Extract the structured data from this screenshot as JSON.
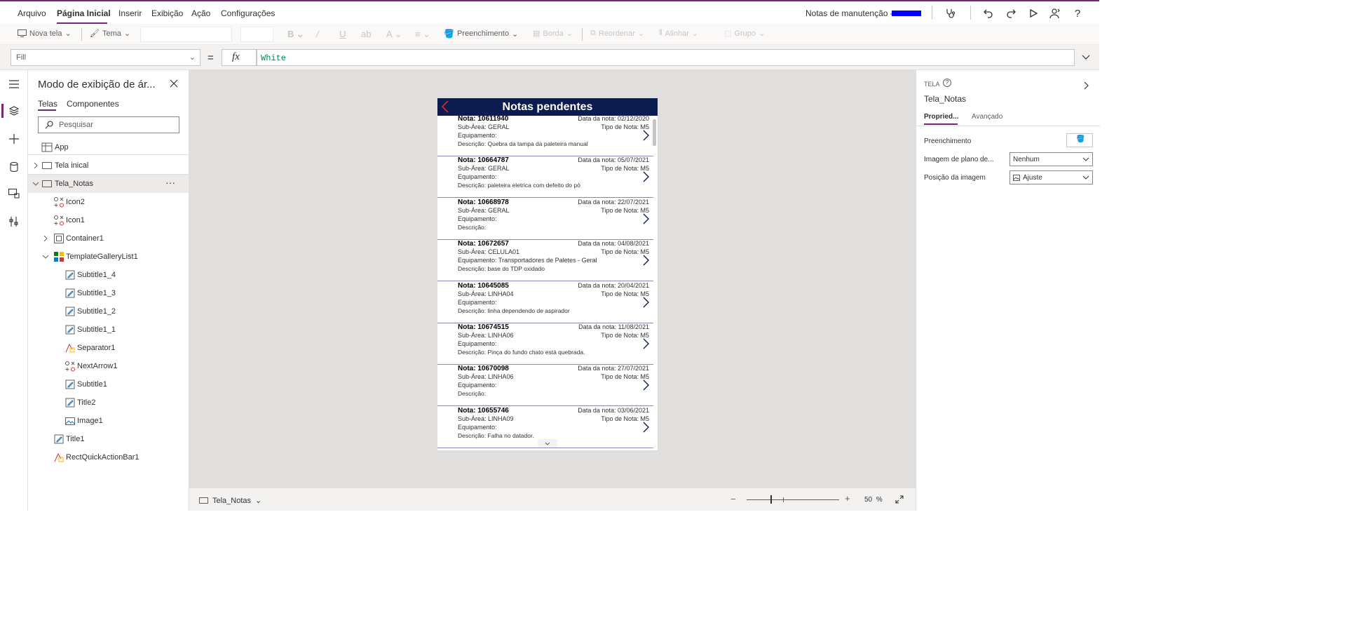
{
  "menu": {
    "items": [
      "Arquivo",
      "Página Inicial",
      "Inserir",
      "Exibição",
      "Ação",
      "Configurações"
    ],
    "active_index": 1
  },
  "app": {
    "title": "Notas de manutenção - "
  },
  "ribbon": {
    "new_screen": "Nova tela",
    "theme": "Tema",
    "fill": "Preenchimento",
    "border": "Borda",
    "reorder": "Reordenar",
    "align": "Alinhar",
    "group": "Grupo"
  },
  "formula": {
    "property": "Fill",
    "equals": "=",
    "fx": "fx",
    "value": "White"
  },
  "tree": {
    "title": "Modo de exibição de ár...",
    "tabs": [
      "Telas",
      "Componentes"
    ],
    "search_placeholder": "Pesquisar",
    "app_label": "App",
    "screens": [
      {
        "label": "Tela inical"
      },
      {
        "label": "Tela_Notas"
      }
    ],
    "children": [
      {
        "label": "Icon2",
        "icon": "icon-control-icon"
      },
      {
        "label": "Icon1",
        "icon": "icon-control-icon"
      },
      {
        "label": "Container1",
        "icon": "container-icon"
      },
      {
        "label": "TemplateGalleryList1",
        "icon": "gallery-icon"
      },
      {
        "label": "Subtitle1_4",
        "icon": "label-edit-icon"
      },
      {
        "label": "Subtitle1_3",
        "icon": "label-edit-icon"
      },
      {
        "label": "Subtitle1_2",
        "icon": "label-edit-icon"
      },
      {
        "label": "Subtitle1_1",
        "icon": "label-edit-icon"
      },
      {
        "label": "Separator1",
        "icon": "shape-icon"
      },
      {
        "label": "NextArrow1",
        "icon": "icon-control-icon"
      },
      {
        "label": "Subtitle1",
        "icon": "label-edit-icon"
      },
      {
        "label": "Title2",
        "icon": "label-edit-icon"
      },
      {
        "label": "Image1",
        "icon": "image-icon"
      },
      {
        "label": "Title1",
        "icon": "label-edit-icon"
      },
      {
        "label": "RectQuickActionBar1",
        "icon": "shape-icon"
      }
    ]
  },
  "phone": {
    "title": "Notas pendentes",
    "header_color": "#0c1c4e",
    "notes": [
      {
        "nota": "Nota: 10611940",
        "data": "Data da nota: 02/12/2020",
        "subarea": "Sub-Área: GERAL",
        "tipo": "Tipo de Nota: M5",
        "equip": "Equipamento:",
        "desc": "Descrição: Quebra da tampa da paleteira manual"
      },
      {
        "nota": "Nota: 10664787",
        "data": "Data da nota: 05/07/2021",
        "subarea": "Sub-Área: GERAL",
        "tipo": "Tipo de Nota: M5",
        "equip": "Equipamento:",
        "desc": "Descrição: paleteira eletrica com defeito do pó"
      },
      {
        "nota": "Nota: 10668978",
        "data": "Data da nota: 22/07/2021",
        "subarea": "Sub-Área: GERAL",
        "tipo": "Tipo de Nota: M5",
        "equip": "Equipamento:",
        "desc": "Descrição:"
      },
      {
        "nota": "Nota: 10672657",
        "data": "Data da nota: 04/08/2021",
        "subarea": "Sub-Área: CELULA01",
        "tipo": "Tipo de Nota: M5",
        "equip": "Equipamento: Transportadores  de Paletes - Geral",
        "desc": "Descrição: base do TDP oxidado"
      },
      {
        "nota": "Nota: 10645085",
        "data": "Data da nota: 20/04/2021",
        "subarea": "Sub-Área: LINHA04",
        "tipo": "Tipo de Nota: M5",
        "equip": "Equipamento:",
        "desc": "Descrição: linha dependendo de aspirador"
      },
      {
        "nota": "Nota: 10674515",
        "data": "Data da nota: 11/08/2021",
        "subarea": "Sub-Área: LINHA06",
        "tipo": "Tipo de Nota: M5",
        "equip": "Equipamento:",
        "desc": "Descrição: Pinça do fundo chato está quebrada."
      },
      {
        "nota": "Nota: 10670098",
        "data": "Data da nota: 27/07/2021",
        "subarea": "Sub-Área: LINHA06",
        "tipo": "Tipo de Nota: M5",
        "equip": "Equipamento:",
        "desc": "Descrição:"
      },
      {
        "nota": "Nota: 10655746",
        "data": "Data da nota: 03/06/2021",
        "subarea": "Sub-Área: LINHA09",
        "tipo": "Tipo de Nota: M5",
        "equip": "Equipamento:",
        "desc": "Descrição: Falha no datador."
      }
    ]
  },
  "bottombar": {
    "screen": "Tela_Notas",
    "zoom": "50",
    "zoom_unit": "%"
  },
  "props": {
    "kind": "TELA",
    "name": "Tela_Notas",
    "tabs": [
      "Propried...",
      "Avançado"
    ],
    "fill_label": "Preenchimento",
    "bg_image_label": "Imagem de plano de...",
    "bg_image_value": "Nenhum",
    "image_pos_label": "Posição da imagem",
    "image_pos_value": "Ajuste"
  },
  "colors": {
    "accent": "#742774",
    "redaction": "#0000ff"
  }
}
